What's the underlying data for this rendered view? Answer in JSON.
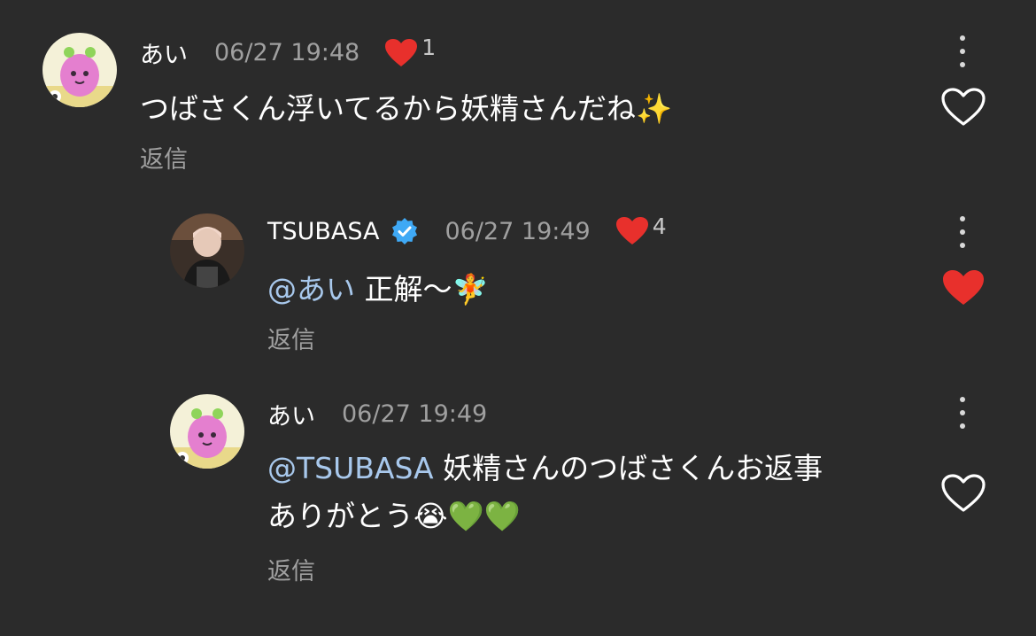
{
  "comments": [
    {
      "username": "あい",
      "timestamp": "06/27 19:48",
      "likes": "1",
      "mention": "",
      "text": "つばさくん浮いてるから妖精さんだね✨",
      "text2": "",
      "reply": "返信",
      "liked": false
    },
    {
      "username": "TSUBASA",
      "verified": true,
      "timestamp": "06/27 19:49",
      "likes": "4",
      "mention": "@あい",
      "text": " 正解〜🧚",
      "text2": "",
      "reply": "返信",
      "liked": true
    },
    {
      "username": "あい",
      "timestamp": "06/27 19:49",
      "likes": "",
      "mention": "@TSUBASA",
      "text": " 妖精さんのつばさくんお返事",
      "text2": "ありがとう😭💚💚",
      "reply": "返信",
      "liked": false
    }
  ],
  "colors": {
    "background": "#2b2b2b",
    "heart_red": "#e8302c",
    "mention": "#a8c8ec",
    "muted": "#a0a0a0",
    "verified": "#3fa9f5"
  }
}
